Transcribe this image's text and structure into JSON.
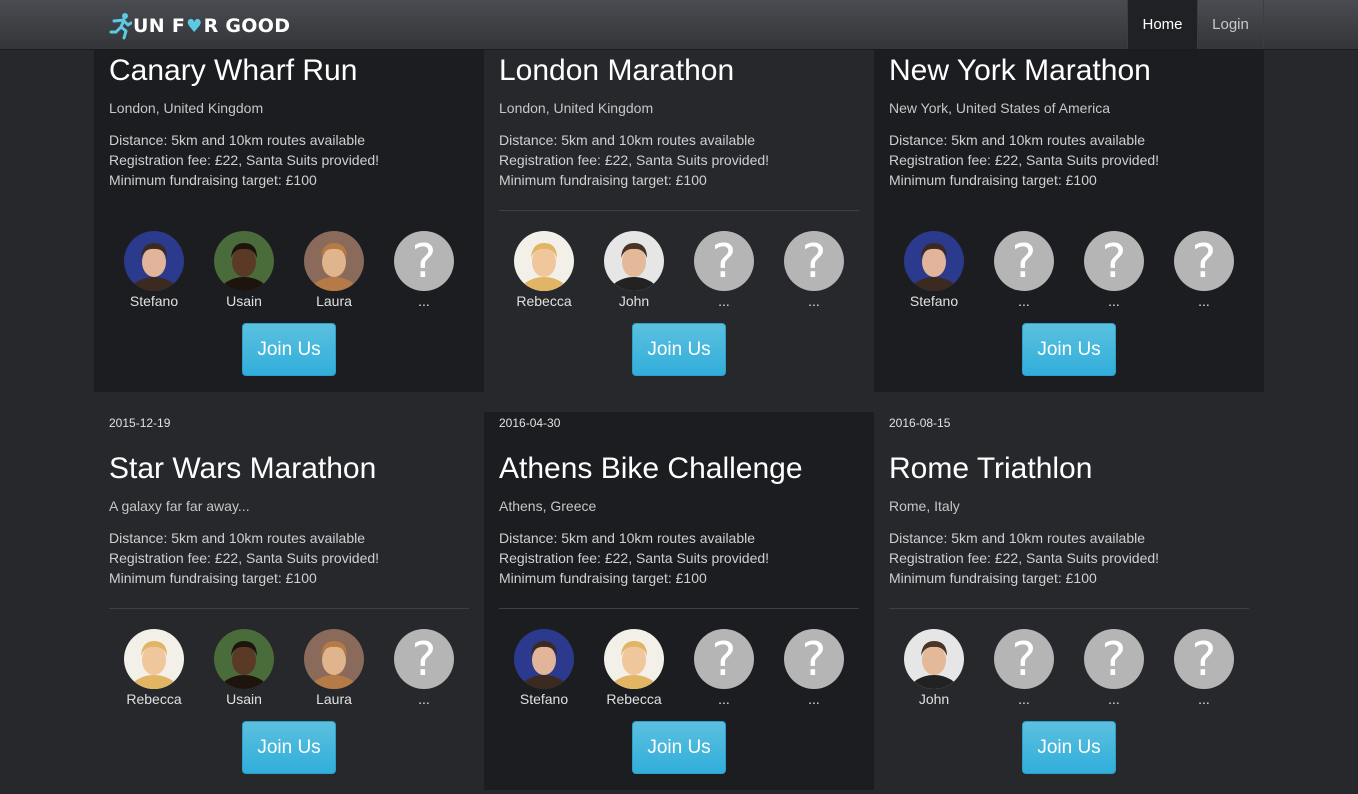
{
  "brand": {
    "pre": "UN F",
    "heart": "♥",
    "post": "R GOOD"
  },
  "nav": {
    "home": "Home",
    "login": "Login"
  },
  "join_label": "Join Us",
  "cards": [
    {
      "date": "",
      "title": "Canary Wharf Run",
      "location": "London, United Kingdom",
      "distance": "Distance: 5km and 10km routes available",
      "fee": "Registration fee: £22, Santa Suits provided!",
      "target": "Minimum fundraising target: £100",
      "runners": [
        {
          "name": "Stefano",
          "avatar": "stefano"
        },
        {
          "name": "Usain",
          "avatar": "usain"
        },
        {
          "name": "Laura",
          "avatar": "laura"
        },
        {
          "name": "...",
          "avatar": "unknown"
        }
      ]
    },
    {
      "date": "",
      "title": "London Marathon",
      "location": "London, United Kingdom",
      "distance": "Distance: 5km and 10km routes available",
      "fee": "Registration fee: £22, Santa Suits provided!",
      "target": "Minimum fundraising target: £100",
      "runners": [
        {
          "name": "Rebecca",
          "avatar": "rebecca"
        },
        {
          "name": "John",
          "avatar": "john"
        },
        {
          "name": "...",
          "avatar": "unknown"
        },
        {
          "name": "...",
          "avatar": "unknown"
        }
      ]
    },
    {
      "date": "",
      "title": "New York Marathon",
      "location": "New York, United States of America",
      "distance": "Distance: 5km and 10km routes available",
      "fee": "Registration fee: £22, Santa Suits provided!",
      "target": "Minimum fundraising target: £100",
      "runners": [
        {
          "name": "Stefano",
          "avatar": "stefano"
        },
        {
          "name": "...",
          "avatar": "unknown"
        },
        {
          "name": "...",
          "avatar": "unknown"
        },
        {
          "name": "...",
          "avatar": "unknown"
        }
      ]
    },
    {
      "date": "2015-12-19",
      "title": "Star Wars Marathon",
      "location": "A galaxy far far away...",
      "distance": "Distance: 5km and 10km routes available",
      "fee": "Registration fee: £22, Santa Suits provided!",
      "target": "Minimum fundraising target: £100",
      "runners": [
        {
          "name": "Rebecca",
          "avatar": "rebecca"
        },
        {
          "name": "Usain",
          "avatar": "usain"
        },
        {
          "name": "Laura",
          "avatar": "laura"
        },
        {
          "name": "...",
          "avatar": "unknown"
        }
      ]
    },
    {
      "date": "2016-04-30",
      "title": "Athens Bike Challenge",
      "location": "Athens, Greece",
      "distance": "Distance: 5km and 10km routes available",
      "fee": "Registration fee: £22, Santa Suits provided!",
      "target": "Minimum fundraising target: £100",
      "runners": [
        {
          "name": "Stefano",
          "avatar": "stefano"
        },
        {
          "name": "Rebecca",
          "avatar": "rebecca"
        },
        {
          "name": "...",
          "avatar": "unknown"
        },
        {
          "name": "...",
          "avatar": "unknown"
        }
      ]
    },
    {
      "date": "2016-08-15",
      "title": "Rome Triathlon",
      "location": "Rome, Italy",
      "distance": "Distance: 5km and 10km routes available",
      "fee": "Registration fee: £22, Santa Suits provided!",
      "target": "Minimum fundraising target: £100",
      "runners": [
        {
          "name": "John",
          "avatar": "john"
        },
        {
          "name": "...",
          "avatar": "unknown"
        },
        {
          "name": "...",
          "avatar": "unknown"
        },
        {
          "name": "...",
          "avatar": "unknown"
        }
      ]
    }
  ],
  "colors": {
    "accent": "#5bc0de",
    "background": "#26282c",
    "card_dark": "#1c1d20"
  }
}
